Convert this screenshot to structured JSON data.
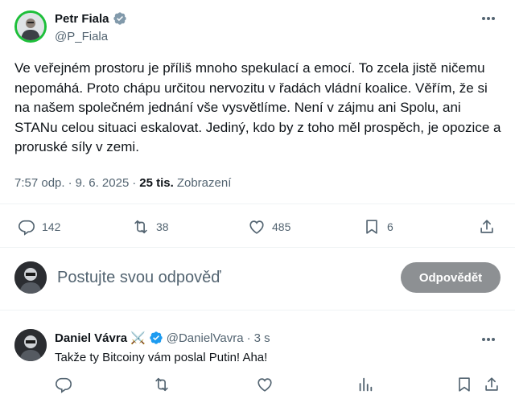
{
  "tweet": {
    "author_name": "Petr Fiala",
    "author_handle": "@P_Fiala",
    "text": "Ve veřejném prostoru je příliš mnoho spekulací a emocí. To zcela jistě ničemu nepomáhá. Proto chápu určitou nervozitu v řadách vládní koalice. Věřím, že si na našem společném jednání vše vysvětlíme. Není v zájmu ani Spolu, ani STANu celou situaci eskalovat. Jediný, kdo by z toho měl prospěch, je opozice a proruské síly v zemi.",
    "time": "7:57 odp.",
    "dot": "·",
    "date": "9. 6. 2025",
    "dot2": "·",
    "views_count": "25 tis.",
    "views_label": "Zobrazení",
    "replies": "142",
    "reposts": "38",
    "likes": "485",
    "bookmarks": "6"
  },
  "composer": {
    "placeholder": "Postujte svou odpověď",
    "button": "Odpovědět"
  },
  "reply": {
    "author_name": "Daniel Vávra",
    "badge": "⚔️",
    "handle": "@DanielVavra",
    "dot": "·",
    "time": "3 s",
    "text": "Takže ty Bitcoiny vám poslal Putin! Aha!"
  },
  "colors": {
    "verified": "#829aab",
    "avatar_ring": "#1dbf3a",
    "reply_button_bg": "#8d9093"
  },
  "icons": [
    "verified-badge-icon",
    "more-icon",
    "reply-icon",
    "repost-icon",
    "like-icon",
    "bookmark-icon",
    "share-icon",
    "views-icon"
  ]
}
